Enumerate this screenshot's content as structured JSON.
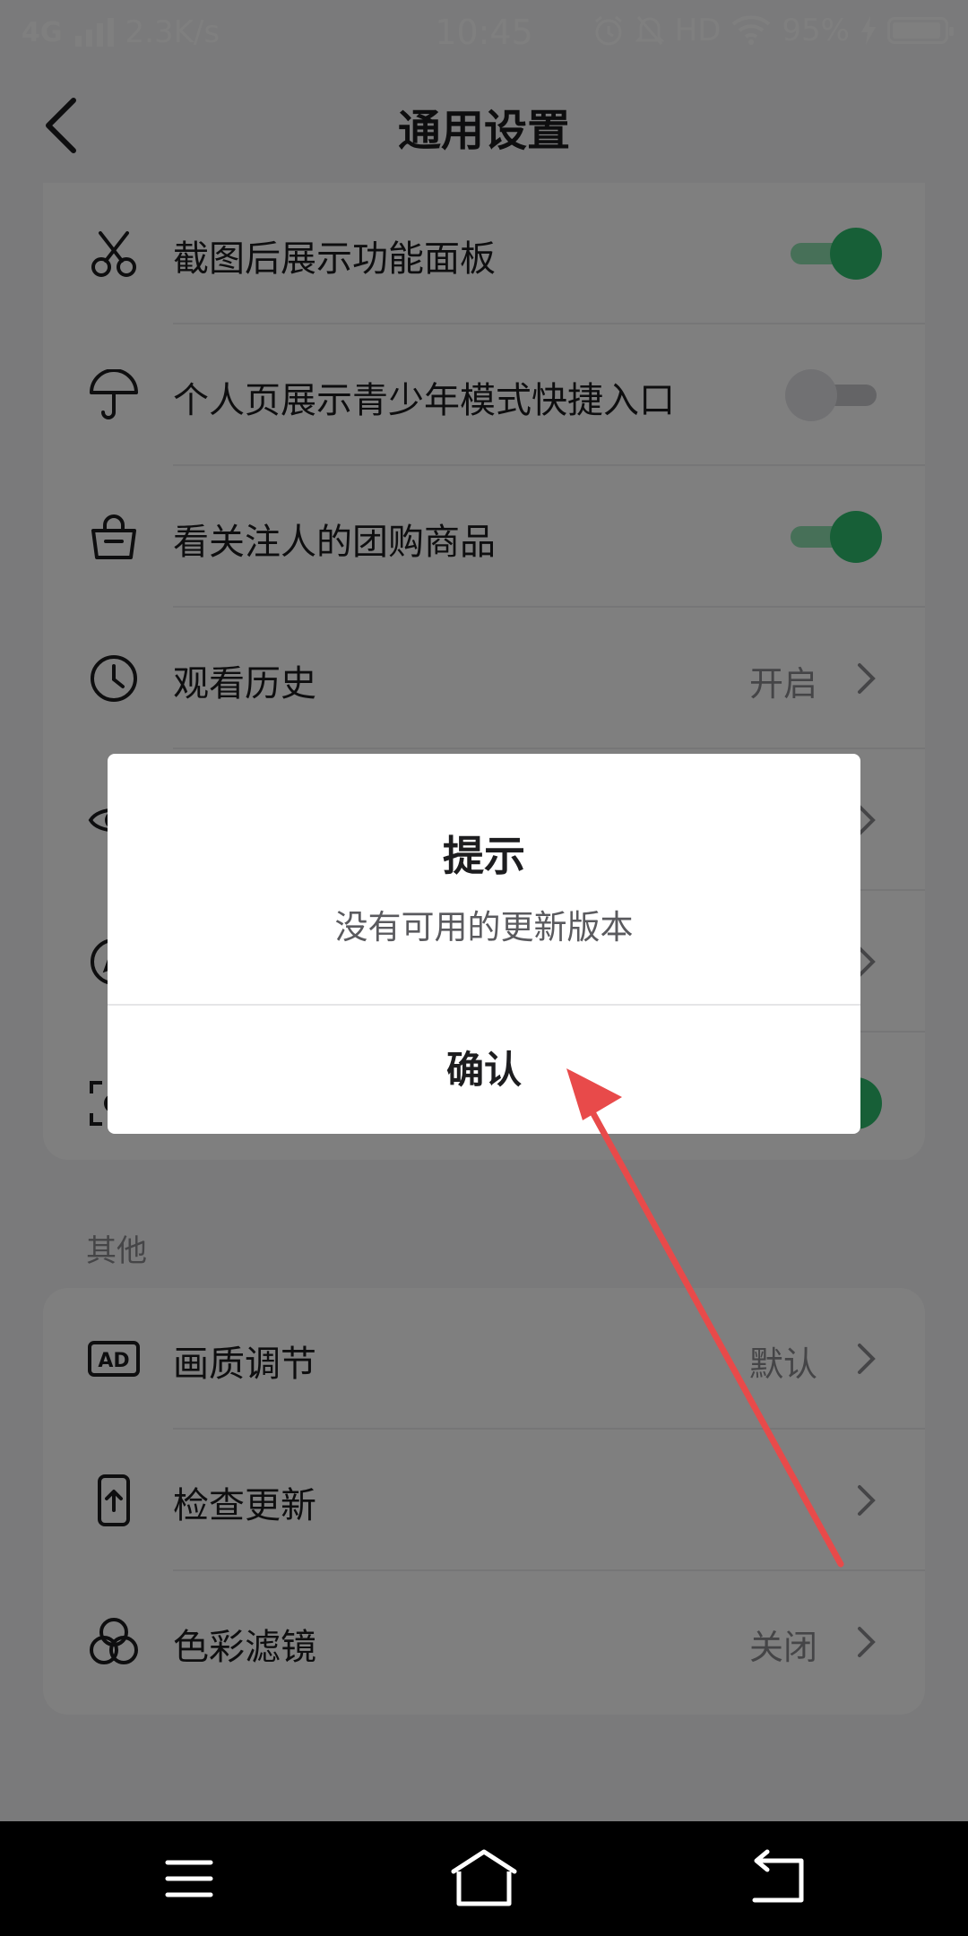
{
  "status_bar": {
    "network": "4G",
    "speed": "2.3K/s",
    "time": "10:45",
    "hd": "HD",
    "battery_percent": "95%",
    "battery_level": 0.95
  },
  "header": {
    "title": "通用设置"
  },
  "settings": [
    {
      "label": "截图后展示功能面板",
      "icon": "scissors-icon",
      "control": "toggle",
      "on": true
    },
    {
      "label": "个人页展示青少年模式快捷入口",
      "icon": "umbrella-icon",
      "control": "toggle",
      "on": false
    },
    {
      "label": "看关注人的团购商品",
      "icon": "shopping-bag-icon",
      "control": "toggle",
      "on": true
    },
    {
      "label": "观看历史",
      "icon": "clock-icon",
      "control": "link",
      "value": "开启"
    },
    {
      "icon": "eye-icon",
      "control": "link"
    },
    {
      "icon": "compass-icon",
      "control": "link"
    },
    {
      "icon": "scan-icon",
      "control": "toggle",
      "on": true
    }
  ],
  "other_section": {
    "title": "其他",
    "items": [
      {
        "label": "画质调节",
        "icon": "ad-icon",
        "value": "默认"
      },
      {
        "label": "检查更新",
        "icon": "phone-upload-icon",
        "value": ""
      },
      {
        "label": "色彩滤镜",
        "icon": "color-filter-icon",
        "value": "关闭"
      }
    ]
  },
  "dialog": {
    "title": "提示",
    "message": "没有可用的更新版本",
    "confirm_label": "确认"
  },
  "colors": {
    "toggle_on": "#2fbe6e",
    "annotation_arrow": "#e84a4a"
  }
}
